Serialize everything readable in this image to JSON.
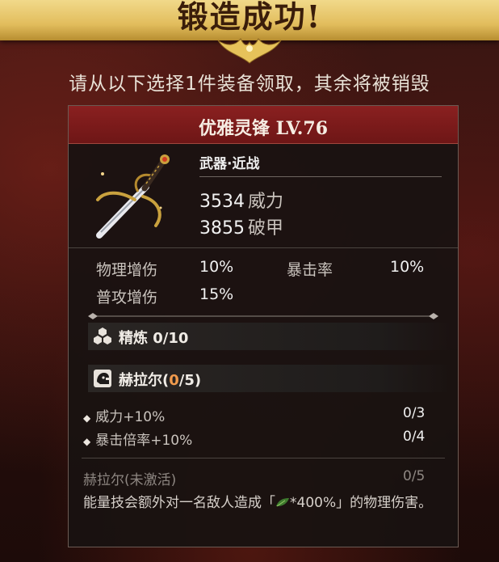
{
  "banner": {
    "title": "锻造成功!"
  },
  "subtitle": "请从以下选择1件装备领取，其余将被销毁",
  "item": {
    "name": "优雅灵锋 LV.76",
    "type": "武器·近战",
    "main_stats": [
      {
        "value": "3534",
        "label": "威力"
      },
      {
        "value": "3855",
        "label": "破甲"
      }
    ],
    "attributes": [
      {
        "label": "物理增伤",
        "value": "10%"
      },
      {
        "label": "暴击率",
        "value": "10%"
      },
      {
        "label": "普攻增伤",
        "value": "15%"
      }
    ],
    "refine": {
      "label": "精炼 0/10"
    },
    "set": {
      "name_prefix": "赫拉尔(",
      "count": "0",
      "name_suffix": "/5)",
      "bonuses": [
        {
          "label": "威力+10%",
          "value": "0/3"
        },
        {
          "label": "暴击倍率+10%",
          "value": "0/4"
        }
      ],
      "status_label": "赫拉尔(未激活)",
      "status_value": "0/5",
      "desc_part1": "能量技会额外对一名敌人造成「",
      "desc_part2": "*400%」的物理伤害。"
    }
  },
  "colors": {
    "header_red": "#7d1b1b",
    "gold": "#e2bd5d",
    "highlight_orange": "#f09a4c"
  },
  "icons": {
    "refine": "hexagon-cluster-icon",
    "set": "helmet-icon",
    "damage": "leaf-icon"
  }
}
